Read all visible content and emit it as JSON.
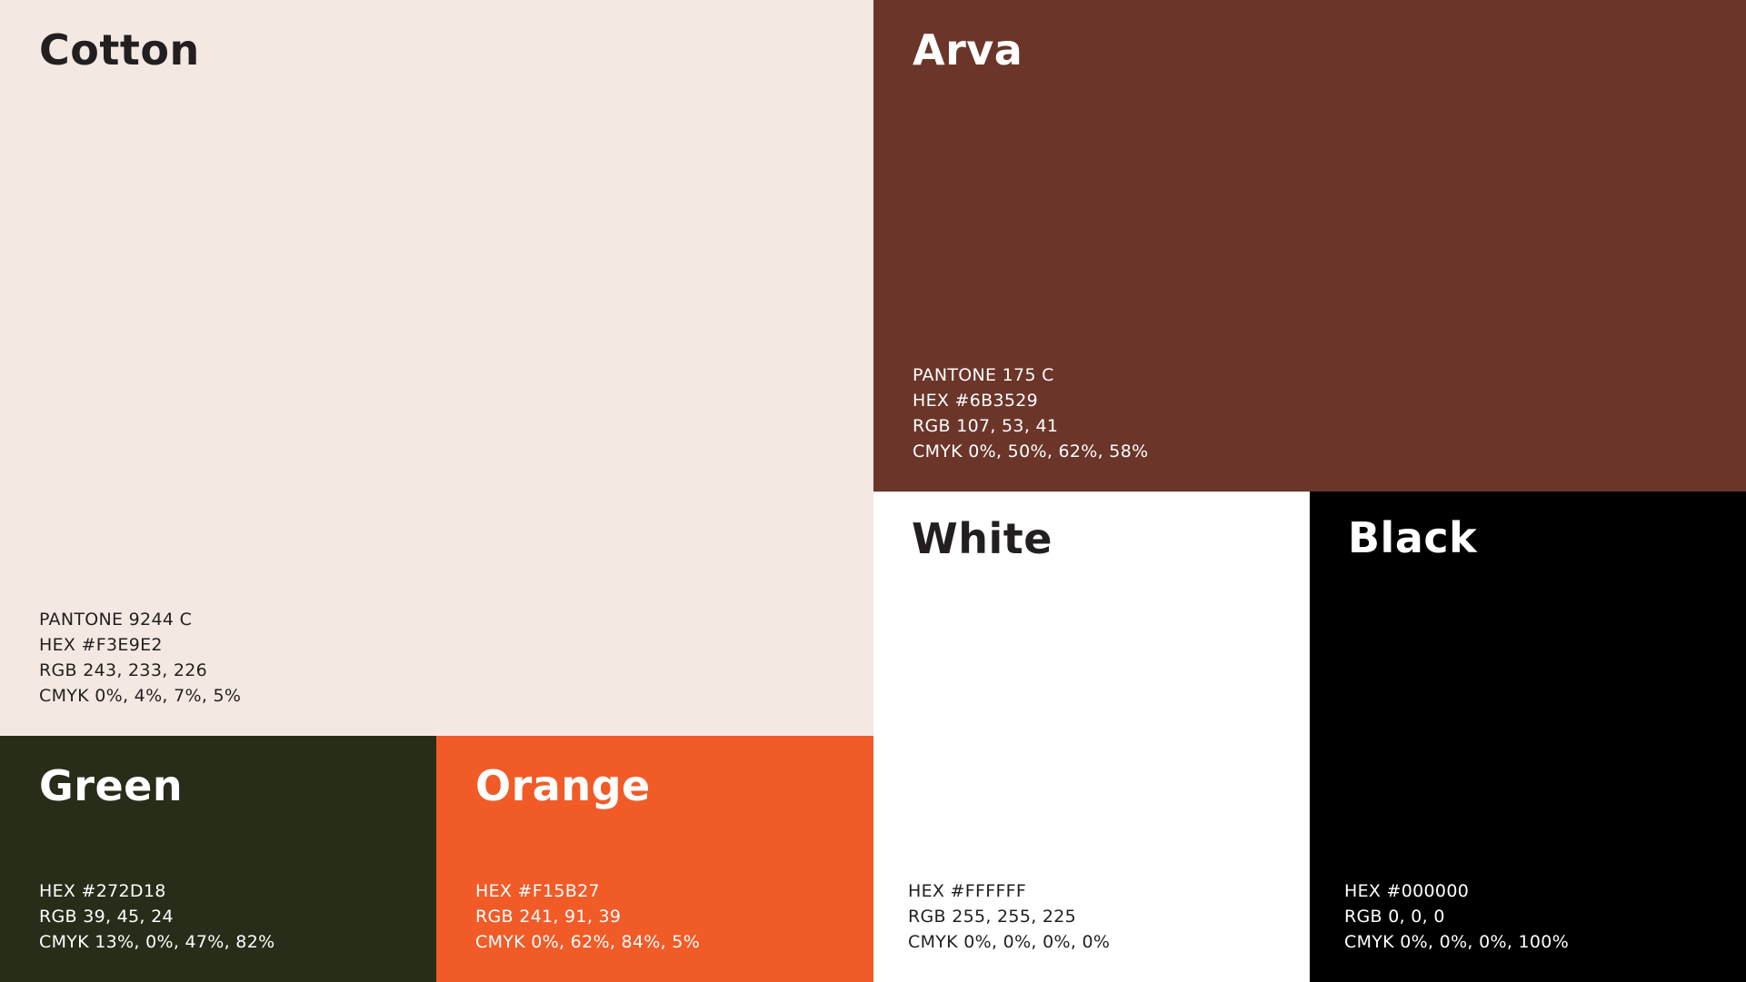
{
  "swatches": [
    {
      "id": "cotton",
      "name": "Cotton",
      "background": "#F3E9E2",
      "text_color": "#231F20",
      "specs": [
        "PANTONE 9244 C",
        "HEX #F3E9E2",
        "RGB 243, 233, 226",
        "CMYK 0%, 4%, 7%, 5%"
      ]
    },
    {
      "id": "arva",
      "name": "Arva",
      "background": "#6B3529",
      "text_color": "#FFFFFF",
      "specs": [
        "PANTONE 175 C",
        "HEX #6B3529",
        "RGB 107, 53, 41",
        "CMYK 0%, 50%, 62%, 58%"
      ]
    },
    {
      "id": "white",
      "name": "White",
      "background": "#FFFFFF",
      "text_color": "#231F20",
      "specs": [
        "HEX #FFFFFF",
        "RGB 255, 255, 225",
        "CMYK 0%, 0%, 0%, 0%"
      ]
    },
    {
      "id": "black",
      "name": "Black",
      "background": "#000000",
      "text_color": "#FFFFFF",
      "specs": [
        "HEX #000000",
        "RGB 0, 0, 0",
        "CMYK 0%, 0%, 0%, 100%"
      ]
    },
    {
      "id": "green",
      "name": "Green",
      "background": "#272D18",
      "text_color": "#FFFFFF",
      "specs": [
        "HEX #272D18",
        "RGB 39, 45, 24",
        "CMYK 13%, 0%, 47%, 82%"
      ]
    },
    {
      "id": "orange",
      "name": "Orange",
      "background": "#F15B27",
      "text_color": "#FFFFFF",
      "specs": [
        "HEX #F15B27",
        "RGB 241, 91, 39",
        "CMYK 0%, 62%, 84%, 5%"
      ]
    }
  ]
}
